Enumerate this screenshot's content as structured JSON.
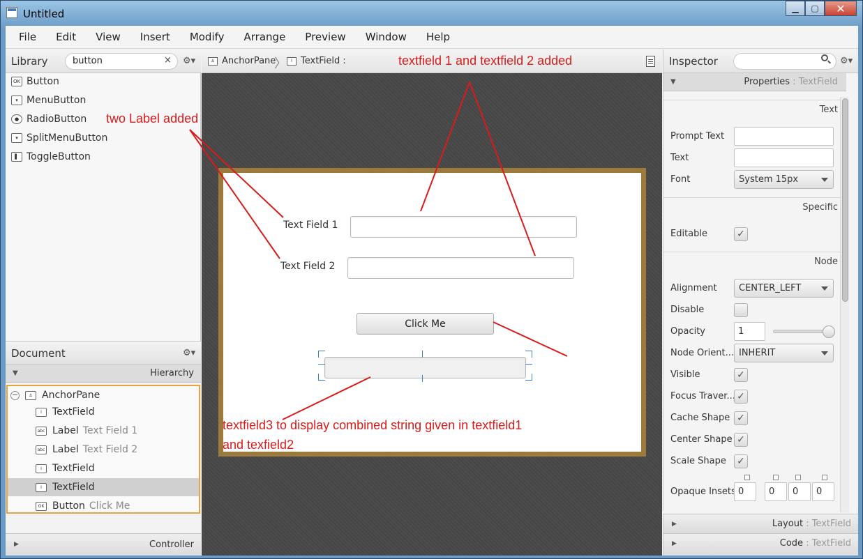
{
  "window": {
    "title": "Untitled",
    "minimize": "▁",
    "maximize": "▢",
    "close": "✕"
  },
  "menu": [
    "File",
    "Edit",
    "View",
    "Insert",
    "Modify",
    "Arrange",
    "Preview",
    "Window",
    "Help"
  ],
  "library": {
    "title": "Library",
    "search_value": "button",
    "clear": "×",
    "gear": "⚙▾",
    "items": [
      {
        "label": "Button",
        "icon": "ok-icon",
        "glyph": "OK"
      },
      {
        "label": "MenuButton",
        "icon": "menubutton-icon",
        "glyph": "▾"
      },
      {
        "label": "RadioButton",
        "icon": "radio-icon",
        "glyph": "●"
      },
      {
        "label": "SplitMenuButton",
        "icon": "splitmenu-icon",
        "glyph": "▾"
      },
      {
        "label": "ToggleButton",
        "icon": "toggle-icon",
        "glyph": "▌"
      }
    ]
  },
  "document": {
    "title": "Document",
    "gear": "⚙▾",
    "hierarchy_label": "Hierarchy",
    "rows": [
      {
        "label": "AnchorPane",
        "sub": "",
        "glyph": "⚓"
      },
      {
        "label": "TextField",
        "sub": "",
        "glyph": "I"
      },
      {
        "label": "Label",
        "sub": "Text Field 1",
        "glyph": "abc"
      },
      {
        "label": "Label",
        "sub": "Text Field 2",
        "glyph": "abc"
      },
      {
        "label": "TextField",
        "sub": "",
        "glyph": "I"
      },
      {
        "label": "TextField",
        "sub": "",
        "glyph": "I"
      },
      {
        "label": "Button",
        "sub": "Click Me",
        "glyph": "OK"
      }
    ],
    "controller_label": "Controller"
  },
  "breadcrumb": {
    "items": [
      "AnchorPane",
      "TextField :"
    ]
  },
  "canvas": {
    "label1": "Text Field 1",
    "label2": "Text Field 2",
    "button": "Click Me"
  },
  "annotations": {
    "top": "textfield 1 and textfield 2 added",
    "labels": "two Label added",
    "bottom_line1": "textfield3 to display combined string given in textfield1",
    "bottom_line2": "and texfield2"
  },
  "inspector": {
    "title": "Inspector",
    "gear": "⚙▾",
    "properties_label": "Properties",
    "properties_target": ": TextField",
    "sections": {
      "text": "Text",
      "specific": "Specific",
      "node": "Node"
    },
    "props": {
      "prompt_text": {
        "label": "Prompt Text",
        "value": ""
      },
      "text": {
        "label": "Text",
        "value": ""
      },
      "font": {
        "label": "Font",
        "value": "System 15px"
      },
      "editable": {
        "label": "Editable",
        "checked": true
      },
      "alignment": {
        "label": "Alignment",
        "value": "CENTER_LEFT"
      },
      "disable": {
        "label": "Disable",
        "checked": false
      },
      "opacity": {
        "label": "Opacity",
        "value": "1",
        "slider_fraction": 1.0
      },
      "node_orient": {
        "label": "Node Orient...",
        "value": "INHERIT"
      },
      "visible": {
        "label": "Visible",
        "checked": true
      },
      "focus_trav": {
        "label": "Focus Traver...",
        "checked": true
      },
      "cache_shape": {
        "label": "Cache Shape",
        "checked": true
      },
      "center_shape": {
        "label": "Center Shape",
        "checked": true
      },
      "scale_shape": {
        "label": "Scale Shape",
        "checked": true
      },
      "opaque_insets": {
        "label": "Opaque Insets",
        "values": [
          "0",
          "0",
          "0",
          "0"
        ]
      }
    },
    "check_glyph": "✓",
    "layout_label": "Layout",
    "code_label": "Code",
    "target": ": TextField"
  },
  "colors": {
    "annotation": "#d81b1b",
    "stage_border": "#9c7a3c",
    "selection": "#e8a33a",
    "canvas_bg": "#464646"
  }
}
